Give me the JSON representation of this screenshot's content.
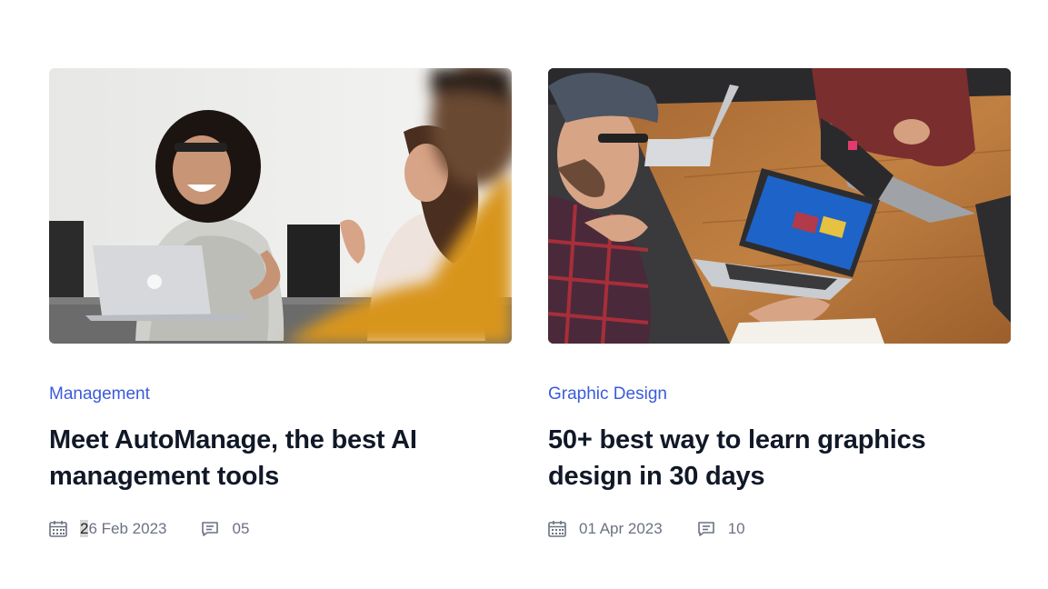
{
  "posts": [
    {
      "image": "team-meeting-photo",
      "category": "Management",
      "title": "Meet AutoManage, the best AI management tools",
      "date_first": "2",
      "date_rest": "6 Feb 2023",
      "comments": "05"
    },
    {
      "image": "laptops-table-photo",
      "category": "Graphic Design",
      "title": "50+ best way to learn graphics design in 30 days",
      "date": "01 Apr 2023",
      "comments": "10"
    }
  ],
  "colors": {
    "accent": "#3b5bdb",
    "title": "#111827",
    "meta": "#6b7280"
  },
  "icons": [
    "calendar-icon",
    "comment-icon"
  ]
}
